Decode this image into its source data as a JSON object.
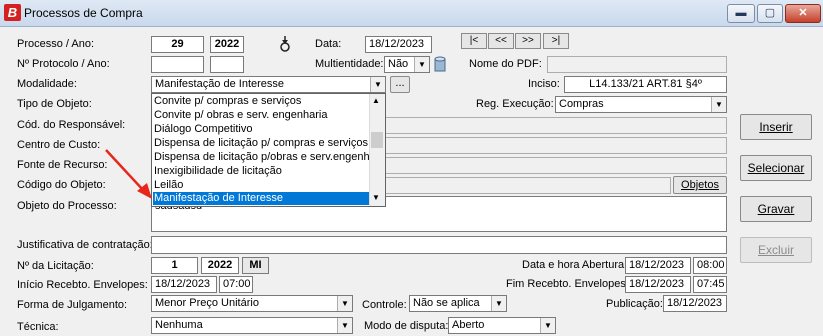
{
  "window": {
    "title": "Processos de Compra",
    "logo_letter": "B",
    "minimize": "▬",
    "maximize": "▢",
    "close": "✕"
  },
  "labels": {
    "processo_ano": "Processo / Ano:",
    "data": "Data:",
    "protocolo": "Nº Protocolo / Ano:",
    "multientidade": "Multientidade:",
    "nome_pdf": "Nome do PDF:",
    "modalidade": "Modalidade:",
    "inciso": "Inciso:",
    "tipo_objeto": "Tipo de Objeto:",
    "reg_execucao": "Reg. Execução:",
    "cod_responsavel": "Cód. do Responsável:",
    "centro_custo": "Centro de Custo:",
    "fonte_recurso": "Fonte de Recurso:",
    "codigo_objeto": "Código do Objeto:",
    "objeto_processo": "Objeto do Processo:",
    "justificativa": "Justificativa de contratação:",
    "num_licitacao": "Nº da Licitação:",
    "data_hora_abertura": "Data e hora Abertura:",
    "inicio_receb": "Início Recebto. Envelopes:",
    "fim_receb": "Fim Recebto. Envelopes:",
    "forma_julgamento": "Forma de Julgamento:",
    "controle": "Controle:",
    "publicacao": "Publicação:",
    "tecnica": "Técnica:",
    "modo_disputa": "Modo de disputa:"
  },
  "values": {
    "processo_num": "29",
    "processo_ano": "2022",
    "data": "18/12/2023",
    "multientidade": "Não",
    "modalidade": "Manifestação de Interesse",
    "ellipsis": "...",
    "inciso": "L14.133/21 ART.81 §4º",
    "reg_execucao": "Compras",
    "objeto_text": "sadsadsd",
    "licitacao_num": "1",
    "licitacao_ano": "2022",
    "licitacao_tipo": "MI",
    "abertura_data": "18/12/2023",
    "abertura_hora": "08:00",
    "inicio_data": "18/12/2023",
    "inicio_hora": "07:00",
    "fim_data": "18/12/2023",
    "fim_hora": "07:45",
    "forma_julgamento": "Menor Preço Unitário",
    "controle": "Não se aplica",
    "publicacao": "18/12/2023",
    "tecnica": "Nenhuma",
    "modo_disputa": "Aberto"
  },
  "nav": {
    "first": "|<",
    "prev": "<<",
    "next": ">>",
    "last": ">|"
  },
  "buttons": {
    "inserir": "Inserir",
    "selecionar": "Selecionar",
    "gravar": "Gravar",
    "excluir": "Excluir",
    "objetos": "Objetos"
  },
  "dropdown_options": [
    "Convite p/ compras e serviços",
    "Convite p/ obras e serv. engenharia",
    "Diálogo Competitivo",
    "Dispensa de licitação p/ compras e serviços",
    "Dispensa de licitação p/obras e serv.engenh.",
    "Inexigibilidade de licitação",
    "Leilão",
    "Manifestação de Interesse"
  ],
  "dropdown_selected_index": 7,
  "colors": {
    "selection": "#0078d7",
    "annotation_arrow": "#e8271c"
  },
  "icons": {
    "multi_icon": "database-icon",
    "process_icon": "gear-arrow-icon"
  }
}
